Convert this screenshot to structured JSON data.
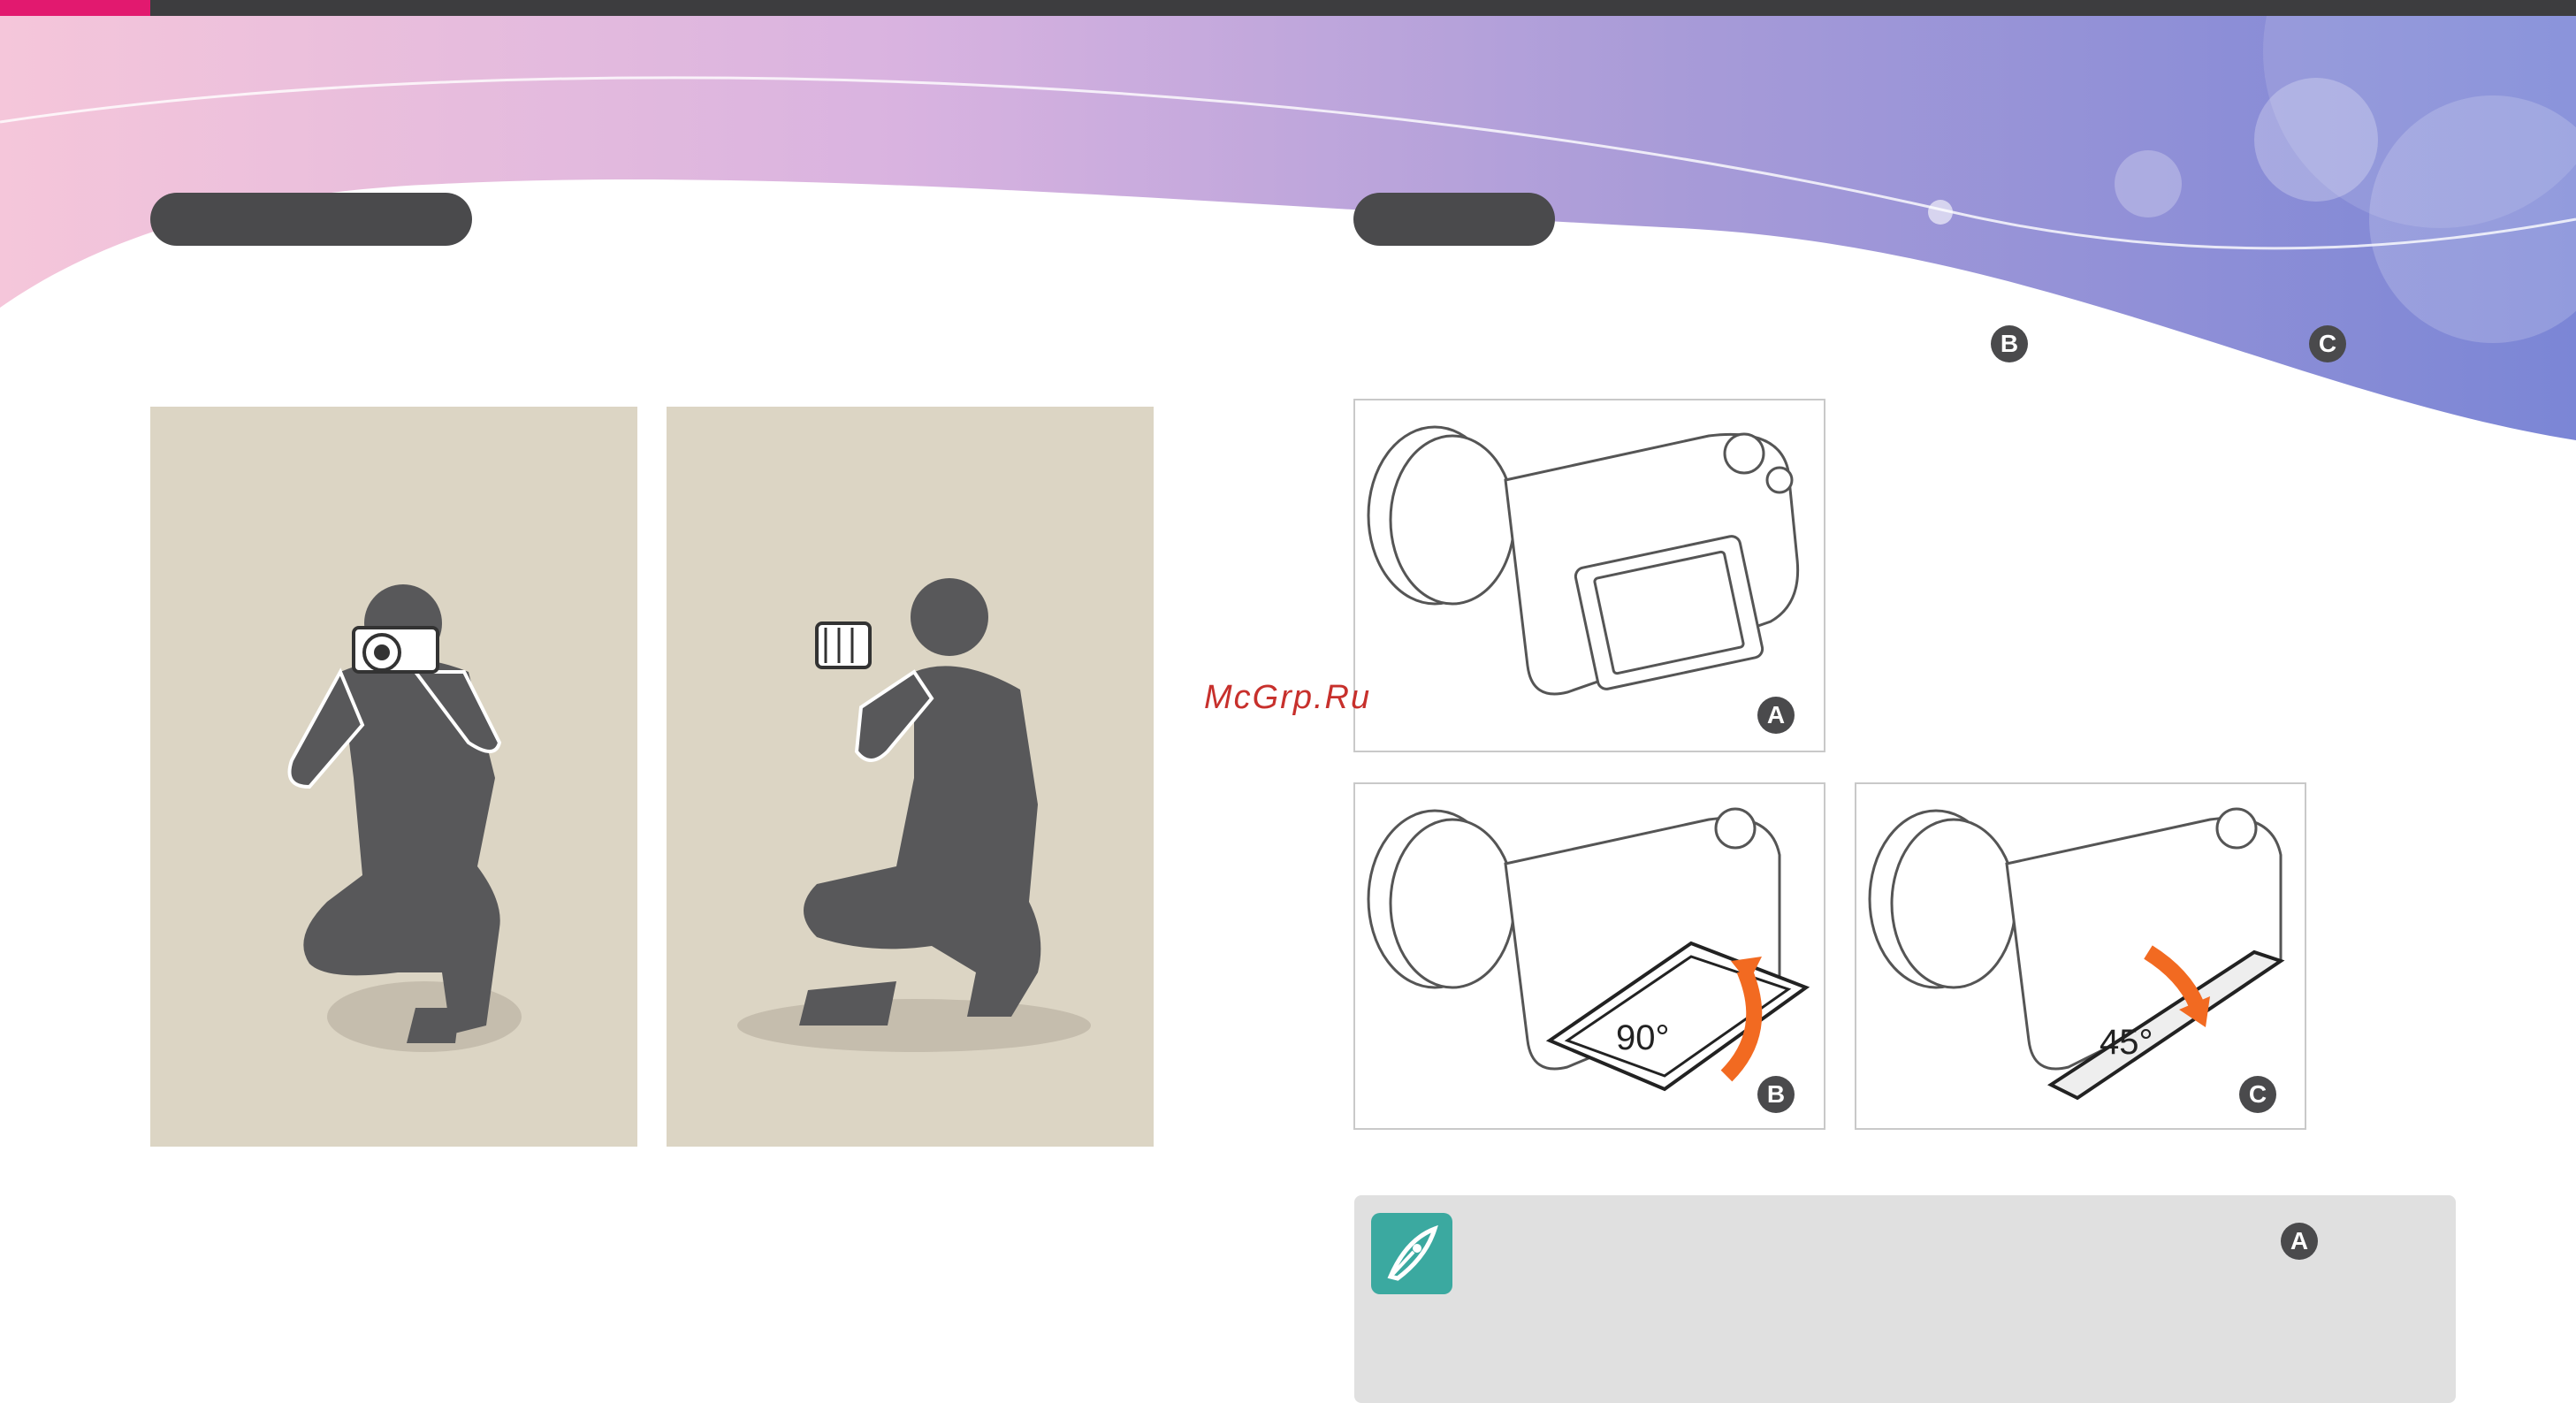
{
  "header": {
    "bar_color": "#3d3d3f",
    "accent_color": "#e2196f"
  },
  "sections": {
    "left_pill_label": "",
    "right_pill_label": ""
  },
  "watermark": "McGrp.Ru",
  "markers": {
    "a": "A",
    "b": "B",
    "c": "C"
  },
  "figures": {
    "screen_tilt_up": "90°",
    "screen_tilt_down": "45°"
  },
  "note": {
    "icon": "pen-note-icon",
    "marker": "A"
  },
  "icons": [
    "pen-note-icon"
  ]
}
